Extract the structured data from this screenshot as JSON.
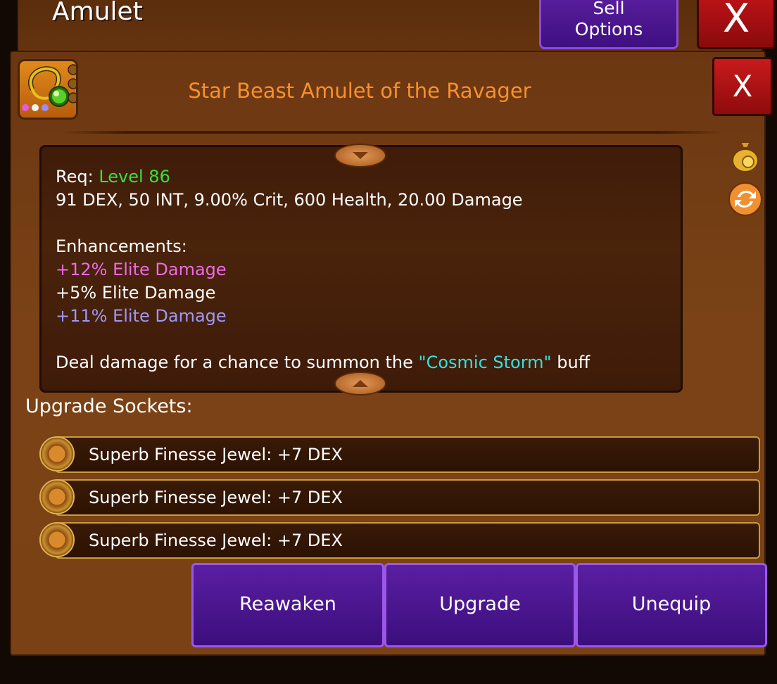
{
  "background_window": {
    "title": "Amulet",
    "sell_options_line1": "Sell",
    "sell_options_line2": "Options",
    "close_label": "X"
  },
  "item": {
    "title": "Star Beast Amulet of the Ravager",
    "close_label": "X",
    "rarity_dots": [
      "#e25ce0",
      "#f2f2f2",
      "#9a8ef0"
    ]
  },
  "description": {
    "req_prefix": "Req: ",
    "req_level": "Level 86",
    "stats": "91 DEX, 50 INT, 9.00% Crit, 600 Health, 20.00 Damage",
    "enhancements_header": "Enhancements:",
    "enhancements": [
      {
        "text": "+12% Elite Damage",
        "color": "#ec6ae6"
      },
      {
        "text": "+5% Elite Damage",
        "color": "#ffffff"
      },
      {
        "text": "+11% Elite Damage",
        "color": "#9f98f4"
      }
    ],
    "effect_prefix": "Deal damage for a chance to summon the ",
    "effect_buff": "\"Cosmic Storm\"",
    "effect_suffix": " buff"
  },
  "sockets": {
    "label": "Upgrade Sockets:",
    "items": [
      "Superb Finesse Jewel: +7 DEX",
      "Superb Finesse Jewel: +7 DEX",
      "Superb Finesse Jewel: +7 DEX"
    ]
  },
  "actions": {
    "reawaken": "Reawaken",
    "upgrade": "Upgrade",
    "unequip": "Unequip"
  },
  "side_icons": [
    "gold-bag-icon",
    "swap-icon"
  ]
}
